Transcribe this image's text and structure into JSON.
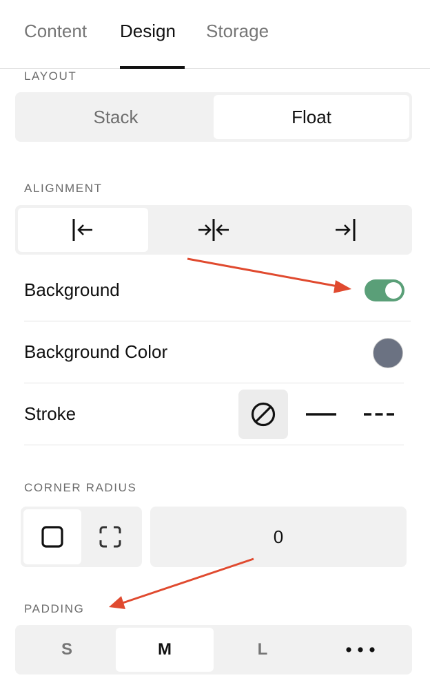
{
  "tabs": [
    {
      "label": "Content",
      "active": false
    },
    {
      "label": "Design",
      "active": true
    },
    {
      "label": "Storage",
      "active": false
    }
  ],
  "layout": {
    "label": "LAYOUT",
    "options": [
      "Stack",
      "Float"
    ],
    "selected": "Float"
  },
  "alignment": {
    "label": "ALIGNMENT",
    "options": [
      {
        "icon": "align-left-icon",
        "selected": true
      },
      {
        "icon": "align-center-icon",
        "selected": false
      },
      {
        "icon": "align-right-icon",
        "selected": false
      }
    ]
  },
  "background": {
    "label": "Background",
    "enabled": true,
    "toggle_color": "#5a9f78"
  },
  "background_color": {
    "label": "Background Color",
    "value": "#6b7282"
  },
  "stroke": {
    "label": "Stroke",
    "options": [
      {
        "icon": "no-stroke-icon",
        "selected": true
      },
      {
        "icon": "solid-stroke-icon",
        "selected": false
      },
      {
        "icon": "dashed-stroke-icon",
        "selected": false
      }
    ]
  },
  "corner_radius": {
    "label": "CORNER RADIUS",
    "modes": [
      {
        "icon": "uniform-corner-icon",
        "selected": true
      },
      {
        "icon": "individual-corners-icon",
        "selected": false
      }
    ],
    "value": "0"
  },
  "padding": {
    "label": "PADDING",
    "options": [
      "S",
      "M",
      "L"
    ],
    "selected": "M",
    "more_icon": "more-options-icon"
  },
  "annotations": {
    "arrow_color": "#e04a2f"
  }
}
